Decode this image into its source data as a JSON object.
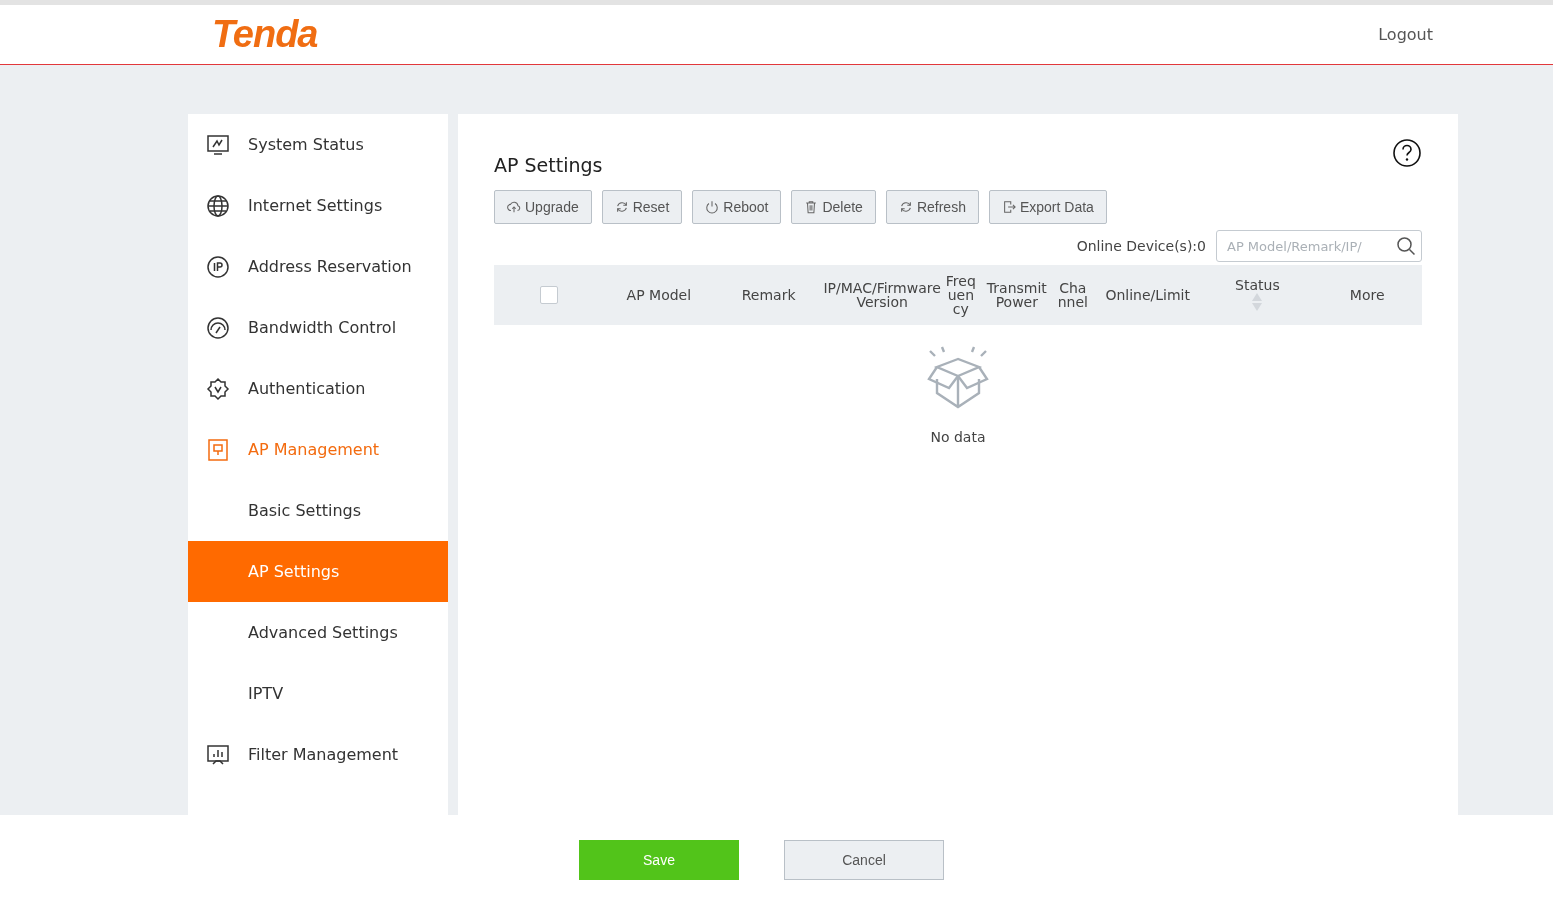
{
  "header": {
    "logo": "Tenda",
    "logout": "Logout"
  },
  "sidebar": {
    "items": [
      {
        "label": "System Status",
        "selected": false
      },
      {
        "label": "Internet Settings",
        "selected": false
      },
      {
        "label": "Address Reservation",
        "selected": false
      },
      {
        "label": "Bandwidth Control",
        "selected": false
      },
      {
        "label": "Authentication",
        "selected": false
      },
      {
        "label": "AP Management",
        "selected": true,
        "children": [
          {
            "label": "Basic Settings",
            "selected": false
          },
          {
            "label": "AP Settings",
            "selected": true
          },
          {
            "label": "Advanced Settings",
            "selected": false
          },
          {
            "label": "IPTV",
            "selected": false
          }
        ]
      },
      {
        "label": "Filter Management",
        "selected": false
      }
    ]
  },
  "page": {
    "title": "AP Settings",
    "toolbar": [
      {
        "label": "Upgrade"
      },
      {
        "label": "Reset"
      },
      {
        "label": "Reboot"
      },
      {
        "label": "Delete"
      },
      {
        "label": "Refresh"
      },
      {
        "label": "Export Data"
      }
    ],
    "online_devices": "Online Device(s):0",
    "search": {
      "placeholder": "AP Model/Remark/IP/"
    },
    "table": {
      "select_all": {
        "checked": false
      },
      "columns": [
        {
          "label": "AP Model",
          "kind": "wide"
        },
        {
          "label": "Remark",
          "kind": "wide"
        },
        {
          "label": "IP/MAC/Firmware Version",
          "kind": "wide"
        },
        {
          "label": "Frequency",
          "kind": "narrow"
        },
        {
          "label": "Transmit Power",
          "kind": "medium"
        },
        {
          "label": "Channel",
          "kind": "narrow"
        },
        {
          "label": "Online/Limit",
          "kind": "wide"
        },
        {
          "label": "Status",
          "kind": "sortable"
        },
        {
          "label": "More",
          "kind": "wide"
        }
      ],
      "empty": "No data"
    }
  },
  "footer": {
    "save": "Save",
    "cancel": "Cancel"
  }
}
